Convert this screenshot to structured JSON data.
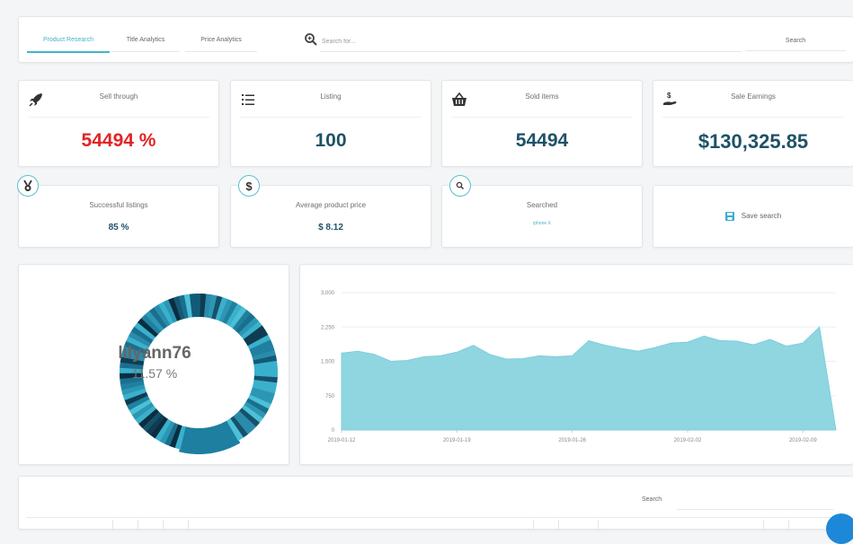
{
  "tabs": [
    {
      "label": "Product Research",
      "active": true
    },
    {
      "label": "Title Analytics",
      "active": false
    },
    {
      "label": "Price Analytics",
      "active": false
    }
  ],
  "search": {
    "placeholder": "Search for...",
    "button_label": "Search"
  },
  "stats": {
    "sell_through": {
      "label": "Sell through",
      "value": "54494 %",
      "icon": "rocket-icon"
    },
    "listing": {
      "label": "Listing",
      "value": "100",
      "icon": "list-icon"
    },
    "sold_items": {
      "label": "Sold items",
      "value": "54494",
      "icon": "basket-icon"
    },
    "sale_earnings": {
      "label": "Sale Earnings",
      "value": "$130,325.85",
      "icon": "money-hand-icon"
    }
  },
  "small_stats": {
    "successful_listings": {
      "label": "Successful listings",
      "value": "85 %",
      "icon": "medal-icon"
    },
    "average_price": {
      "label": "Average product price",
      "value": "$ 8.12",
      "icon": "dollar-icon"
    },
    "searched": {
      "label": "Searched",
      "value": "iphone X",
      "icon": "search-icon"
    },
    "save_search": {
      "label": "Save search",
      "icon": "save-icon"
    }
  },
  "donut": {
    "name": "lilyann76",
    "percent_label": "11.57 %",
    "highlight_fraction": 0.1157
  },
  "colors": {
    "accent": "#45b3c8",
    "value_text": "#1e5267",
    "red": "#e02424",
    "area_fill": "#8fd6e1",
    "area_stroke": "#7ccfdc"
  },
  "chart_data": {
    "type": "area",
    "x_labels": [
      "2019-01-12",
      "2019-01-19",
      "2019-01-26",
      "2019-02-02",
      "2019-02-09"
    ],
    "x": [
      "2019-01-12",
      "2019-01-13",
      "2019-01-14",
      "2019-01-15",
      "2019-01-16",
      "2019-01-17",
      "2019-01-18",
      "2019-01-19",
      "2019-01-20",
      "2019-01-21",
      "2019-01-22",
      "2019-01-23",
      "2019-01-24",
      "2019-01-25",
      "2019-01-26",
      "2019-01-27",
      "2019-01-28",
      "2019-01-29",
      "2019-01-30",
      "2019-01-31",
      "2019-02-01",
      "2019-02-02",
      "2019-02-03",
      "2019-02-04",
      "2019-02-05",
      "2019-02-06",
      "2019-02-07",
      "2019-02-08",
      "2019-02-09",
      "2019-02-10",
      "2019-02-11"
    ],
    "values": [
      1680,
      1720,
      1650,
      1500,
      1520,
      1600,
      1620,
      1700,
      1850,
      1650,
      1550,
      1560,
      1620,
      1600,
      1620,
      1950,
      1850,
      1780,
      1720,
      1800,
      1900,
      1920,
      2050,
      1950,
      1940,
      1860,
      1980,
      1830,
      1900,
      2250,
      0
    ],
    "y_ticks": [
      "0",
      "750",
      "1,500",
      "2,250",
      "3,000"
    ],
    "ylim": [
      0,
      3000
    ],
    "grid": true
  },
  "table": {
    "search_label": "Search"
  }
}
